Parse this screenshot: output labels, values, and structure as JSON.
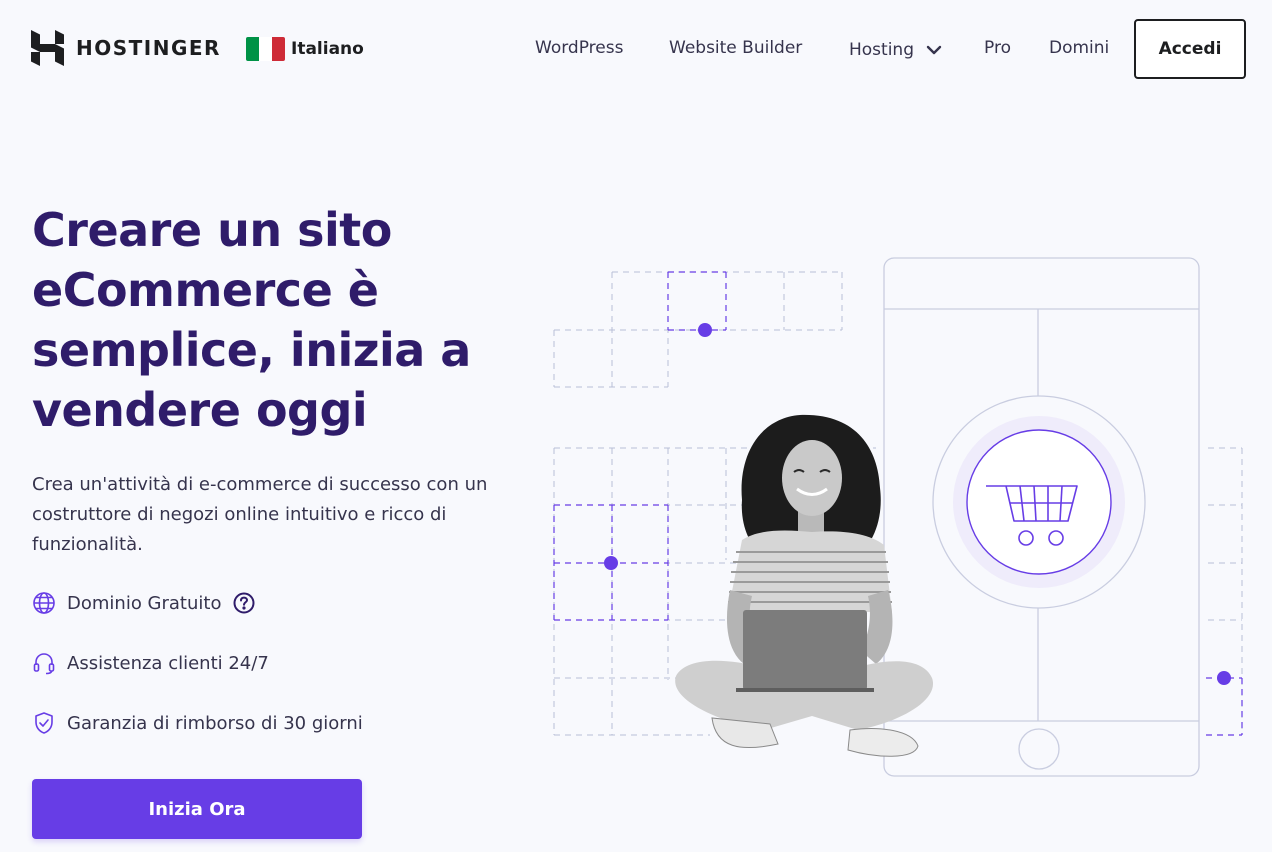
{
  "header": {
    "brand": "HOSTINGER",
    "language": "Italiano",
    "nav": [
      "WordPress",
      "Website Builder",
      "Hosting",
      "Pro",
      "Domini"
    ],
    "login_label": "Accedi"
  },
  "hero": {
    "title_lines": [
      "Creare un sito",
      "eCommerce è",
      "semplice, inizia a",
      "vendere oggi"
    ],
    "description": "Crea un'attività di e-commerce di successo con un costruttore di negozi online intuitivo e ricco di funzionalità.",
    "features": [
      "Dominio Gratuito",
      "Assistenza clienti 24/7",
      "Garanzia di rimborso di 30 giorni"
    ],
    "cta_label": "Inizia Ora"
  },
  "icons": {
    "logo": "hostinger-logo",
    "flag": "italy-flag-icon",
    "dropdown": "chevron-down-icon",
    "features": [
      "globe-icon",
      "headset-icon",
      "shield-check-icon"
    ],
    "help": "question-circle-icon",
    "cart": "shopping-cart-icon"
  },
  "colors": {
    "accent": "#673de6",
    "title": "#2f1c6a",
    "text": "#36344d",
    "background": "#f8f9fd",
    "flag": [
      "#009246",
      "#ffffff",
      "#ce2b37"
    ]
  }
}
